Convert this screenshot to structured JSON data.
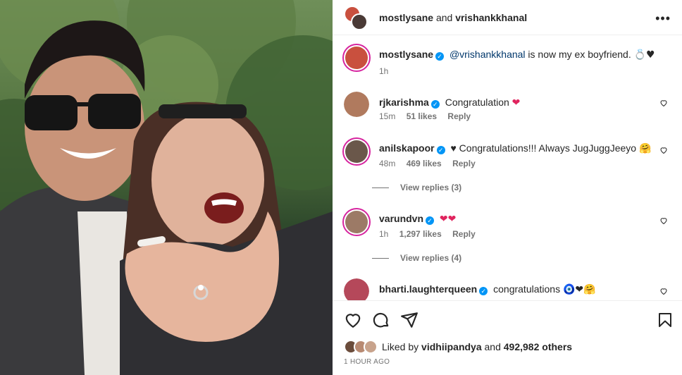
{
  "photo": {
    "alt": "couple selfie showing engagement ring"
  },
  "header": {
    "user1": "mostlysane",
    "and": "and",
    "user2": "vrishankkhanal",
    "more_label": "•••"
  },
  "caption": {
    "username": "mostlysane",
    "mention": "@vrishankkhanal",
    "text": " is now my ex boyfriend. ",
    "emoji": "💍♥",
    "time": "1h"
  },
  "comments": [
    {
      "username": "rjkarishma",
      "text": "Congratulation",
      "emoji": "❤",
      "time": "15m",
      "likes": "51 likes",
      "reply": "Reply"
    },
    {
      "username": "anilskapoor",
      "text": "♥ Congratulations!!! Always JugJuggJeeyo",
      "emoji": "🤗",
      "time": "48m",
      "likes": "469 likes",
      "reply": "Reply",
      "view_replies": "View replies (3)"
    },
    {
      "username": "varundvn",
      "text": "",
      "emoji": "❤❤",
      "time": "1h",
      "likes": "1,297 likes",
      "reply": "Reply",
      "view_replies": "View replies (4)"
    },
    {
      "username": "bharti.laughterqueen",
      "text": "congratulations",
      "emoji": "🧿❤🤗"
    }
  ],
  "likes": {
    "prefix": "Liked by ",
    "user": "vidhiipandya",
    "middle": " and ",
    "count": "492,982 others"
  },
  "time_ago": "1 HOUR AGO",
  "colors": {
    "link": "#00376b",
    "verified": "#0095f6",
    "heart": "#e0245e"
  }
}
